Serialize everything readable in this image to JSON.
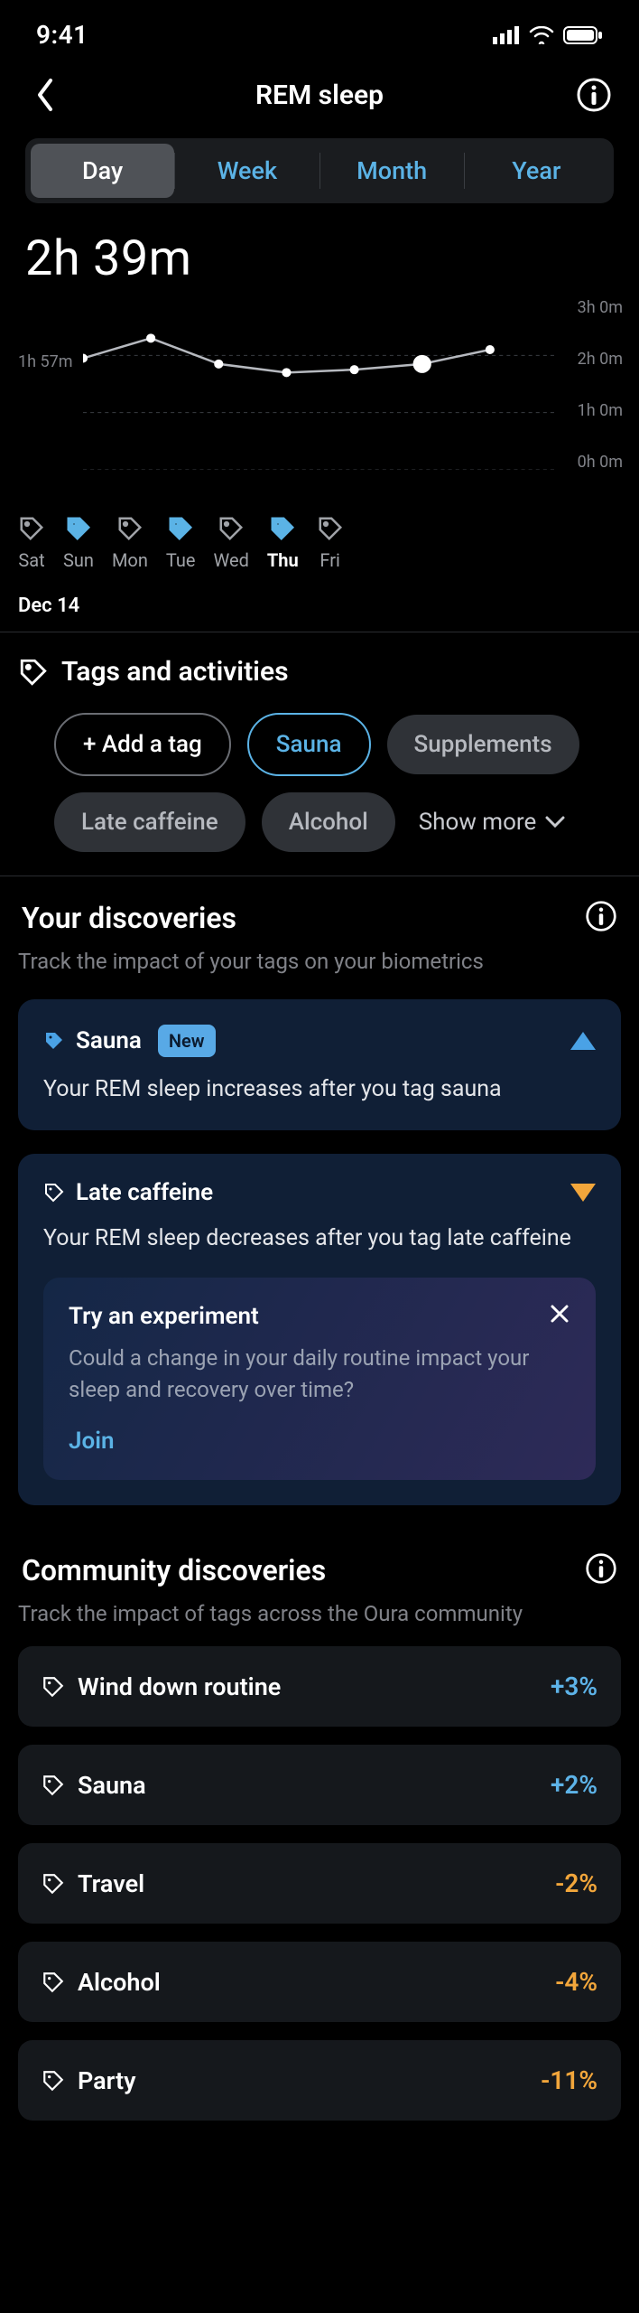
{
  "status": {
    "time": "9:41"
  },
  "header": {
    "title": "REM sleep"
  },
  "tabs": {
    "day": "Day",
    "week": "Week",
    "month": "Month",
    "year": "Year",
    "active": "day"
  },
  "metric": "2h 39m",
  "chart_data": {
    "type": "line",
    "categories": [
      "Sat",
      "Sun",
      "Mon",
      "Tue",
      "Wed",
      "Thu",
      "Fri"
    ],
    "values": [
      1.95,
      2.3,
      1.85,
      1.7,
      1.75,
      1.85,
      2.1,
      null
    ],
    "ylim": [
      0,
      3
    ],
    "ytick_labels": [
      "3h 0m",
      "2h 0m",
      "1h 0m",
      "0h 0m"
    ],
    "left_label": "1h 57m",
    "selected_index": 5
  },
  "days": [
    {
      "label": "Sat",
      "filled": false
    },
    {
      "label": "Sun",
      "filled": true
    },
    {
      "label": "Mon",
      "filled": false
    },
    {
      "label": "Tue",
      "filled": true
    },
    {
      "label": "Wed",
      "filled": false
    },
    {
      "label": "Thu",
      "filled": true,
      "selected": true
    },
    {
      "label": "Fri",
      "filled": false
    }
  ],
  "date_label": "Dec 14",
  "tags_section": {
    "title": "Tags and activities",
    "add": "+ Add a tag",
    "active_tag": "Sauna",
    "chips": [
      "Supplements",
      "Late caffeine",
      "Alcohol"
    ],
    "show_more": "Show more"
  },
  "discoveries": {
    "title": "Your discoveries",
    "sub": "Track the impact of your tags on your biometrics",
    "cards": [
      {
        "tag": "Sauna",
        "new_badge": "New",
        "desc": "Your REM sleep increases after you tag sauna",
        "direction": "up"
      },
      {
        "tag": "Late caffeine",
        "desc": "Your REM sleep decreases after you tag late caffeine",
        "direction": "down"
      }
    ],
    "experiment": {
      "title": "Try an experiment",
      "desc": "Could a change in your daily routine impact your sleep and recovery over time?",
      "cta": "Join"
    }
  },
  "community": {
    "title": "Community discoveries",
    "sub": "Track the impact of tags across the Oura community",
    "rows": [
      {
        "tag": "Wind down routine",
        "val": "+3%",
        "dir": "pos"
      },
      {
        "tag": "Sauna",
        "val": "+2%",
        "dir": "pos"
      },
      {
        "tag": "Travel",
        "val": "-2%",
        "dir": "neg"
      },
      {
        "tag": "Alcohol",
        "val": "-4%",
        "dir": "neg"
      },
      {
        "tag": "Party",
        "val": "-11%",
        "dir": "neg"
      }
    ]
  }
}
